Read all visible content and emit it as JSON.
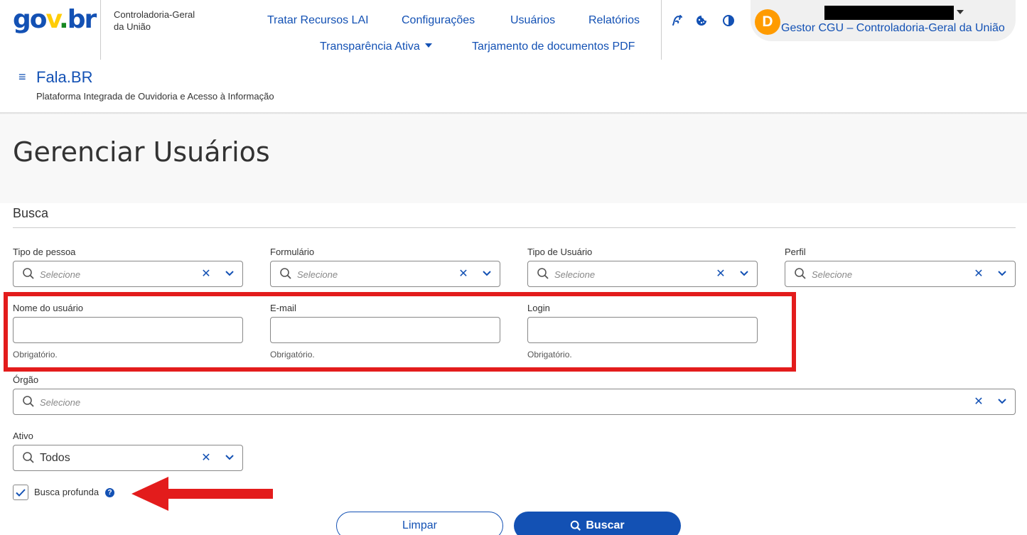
{
  "header": {
    "logo": {
      "part1": "go",
      "part2": "v",
      "part3": ".",
      "part4": "br"
    },
    "org_line1": "Controladoria-Geral",
    "org_line2": "da União",
    "nav": {
      "tratar": "Tratar Recursos LAI",
      "config": "Configurações",
      "usuarios": "Usuários",
      "relatorios": "Relatórios",
      "transparencia": "Transparência Ativa",
      "tarjamento": "Tarjamento de documentos PDF"
    },
    "icons": [
      "sign-language-icon",
      "cookie-icon",
      "contrast-icon"
    ],
    "user": {
      "avatar_letter": "D",
      "role": "Gestor CGU – Controladoria-Geral da União"
    }
  },
  "system": {
    "name": "Fala.BR",
    "subtitle": "Plataforma Integrada de Ouvidoria e Acesso à Informação"
  },
  "page": {
    "title": "Gerenciar Usuários"
  },
  "search": {
    "section_title": "Busca",
    "filters": {
      "tipo_pessoa": {
        "label": "Tipo de pessoa",
        "placeholder": "Selecione"
      },
      "formulario": {
        "label": "Formulário",
        "placeholder": "Selecione"
      },
      "tipo_usuario": {
        "label": "Tipo de Usuário",
        "placeholder": "Selecione"
      },
      "perfil": {
        "label": "Perfil",
        "placeholder": "Selecione"
      },
      "orgao": {
        "label": "Órgão",
        "placeholder": "Selecione"
      },
      "ativo": {
        "label": "Ativo",
        "value": "Todos"
      }
    },
    "inputs": {
      "nome": {
        "label": "Nome do usuário",
        "value": "",
        "hint": "Obrigatório."
      },
      "email": {
        "label": "E-mail",
        "value": "",
        "hint": "Obrigatório."
      },
      "login": {
        "label": "Login",
        "value": "",
        "hint": "Obrigatório."
      }
    },
    "busca_profunda": {
      "label": "Busca profunda",
      "checked": true,
      "help": "?"
    },
    "buttons": {
      "clear": "Limpar",
      "search": "Buscar"
    }
  },
  "colors": {
    "primary": "#1351b4",
    "annotation_red": "#e31c1c",
    "avatar": "#ff9b00"
  }
}
